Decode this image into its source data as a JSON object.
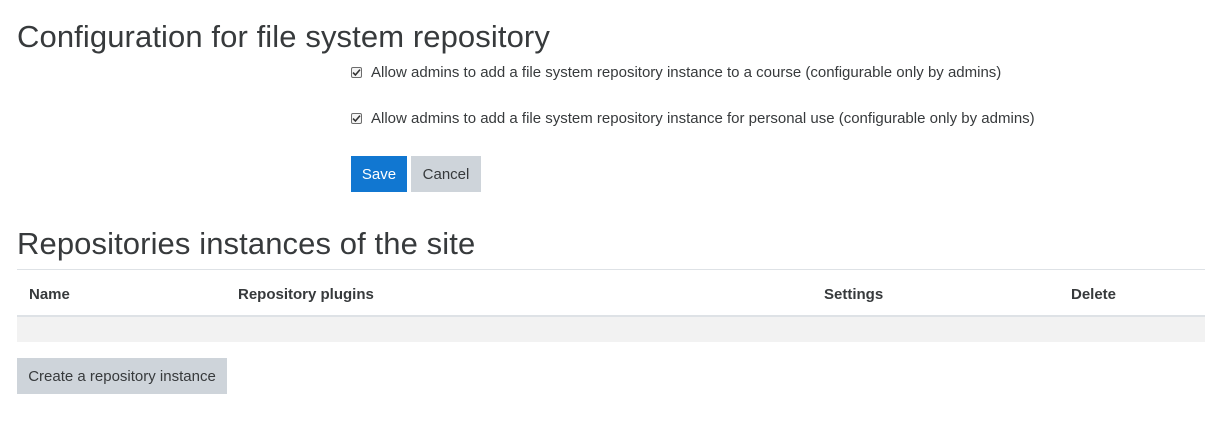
{
  "config": {
    "title": "Configuration for file system repository",
    "options": [
      {
        "label": "Allow admins to add a file system repository instance to a course (configurable only by admins)",
        "checked": true
      },
      {
        "label": "Allow admins to add a file system repository instance for personal use (configurable only by admins)",
        "checked": true
      }
    ],
    "save_label": "Save",
    "cancel_label": "Cancel",
    "save_color": "#1177d1"
  },
  "instances": {
    "title": "Repositories instances of the site",
    "columns": [
      "Name",
      "Repository plugins",
      "Settings",
      "Delete"
    ],
    "rows": [],
    "create_label": "Create a repository instance"
  }
}
